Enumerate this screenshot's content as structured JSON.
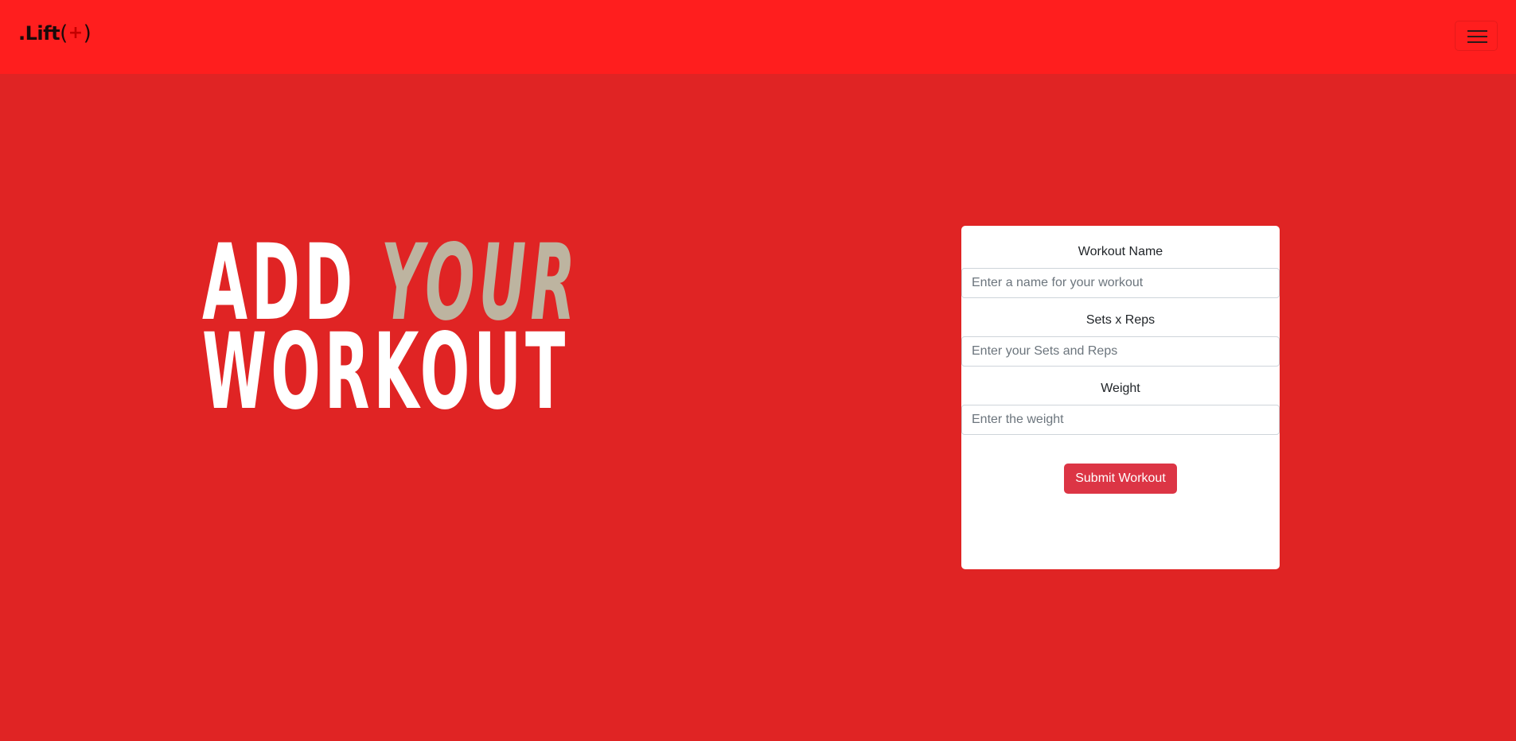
{
  "navbar": {
    "brand": {
      "prefix": ".Lift",
      "open_paren": "(",
      "plus": "+",
      "close_paren": ")"
    },
    "toggler_icon": "hamburger-menu-icon"
  },
  "hero": {
    "word_add": "ADD",
    "word_your": "YOUR",
    "word_workout": "WORKOUT"
  },
  "form": {
    "workout_name_label": "Workout Name",
    "workout_name_placeholder": "Enter a name for your workout",
    "sets_reps_label": "Sets x Reps",
    "sets_reps_placeholder": "Enter your Sets and Reps",
    "weight_label": "Weight",
    "weight_placeholder": "Enter the weight",
    "submit_label": "Submit Workout"
  },
  "colors": {
    "navbar_bg": "#ff1e1e",
    "page_bg": "#e02424",
    "accent_word": "#bdb4a0",
    "submit_button": "#dc3545"
  }
}
